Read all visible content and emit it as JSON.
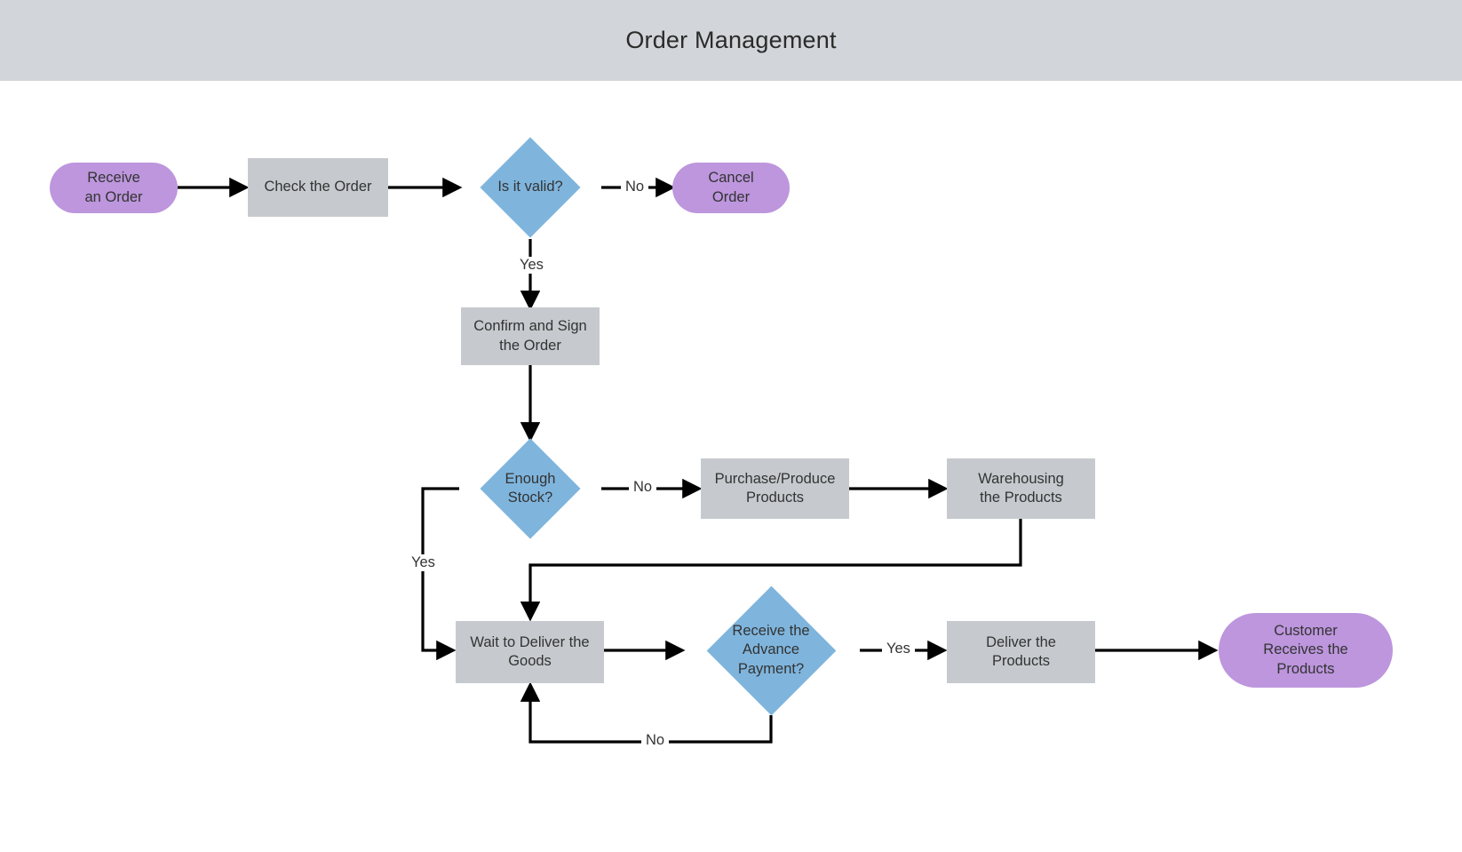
{
  "header": {
    "title": "Order Management",
    "background_color": "#d2d5d9"
  },
  "theme": {
    "terminator_color": "#bd96dd",
    "process_color": "#c6cace",
    "decision_color": "#7fb5dd",
    "line_color": "#000000",
    "text_color": "#333333",
    "canvas_color": "#ffffff"
  },
  "flowchart": {
    "nodes": [
      {
        "id": "receive-an-order",
        "label": "Receive\nan Order",
        "shape": "terminator"
      },
      {
        "id": "check-the-order",
        "label": "Check the Order",
        "shape": "process"
      },
      {
        "id": "is-it-valid",
        "label": "Is it valid?",
        "shape": "decision"
      },
      {
        "id": "cancel-order",
        "label": "Cancel\nOrder",
        "shape": "terminator"
      },
      {
        "id": "confirm-and-sign-the-order",
        "label": "Confirm and Sign\nthe Order",
        "shape": "process"
      },
      {
        "id": "enough-stock",
        "label": "Enough\nStock?",
        "shape": "decision"
      },
      {
        "id": "purchase-produce-products",
        "label": "Purchase/Produce\nProducts",
        "shape": "process"
      },
      {
        "id": "warehousing-the-products",
        "label": "Warehousing\nthe Products",
        "shape": "process"
      },
      {
        "id": "wait-to-deliver-the-goods",
        "label": "Wait to Deliver the\nGoods",
        "shape": "process"
      },
      {
        "id": "receive-the-advance-payment",
        "label": "Receive the\nAdvance\nPayment?",
        "shape": "decision"
      },
      {
        "id": "deliver-the-products",
        "label": "Deliver the\nProducts",
        "shape": "process"
      },
      {
        "id": "customer-receives-the-products",
        "label": "Customer\nReceives the\nProducts",
        "shape": "terminator"
      }
    ],
    "edge_labels": [
      {
        "id": "valid-no",
        "label": "No"
      },
      {
        "id": "valid-yes",
        "label": "Yes"
      },
      {
        "id": "stock-no",
        "label": "No"
      },
      {
        "id": "stock-yes",
        "label": "Yes"
      },
      {
        "id": "payment-yes",
        "label": "Yes"
      },
      {
        "id": "payment-no",
        "label": "No"
      }
    ]
  }
}
